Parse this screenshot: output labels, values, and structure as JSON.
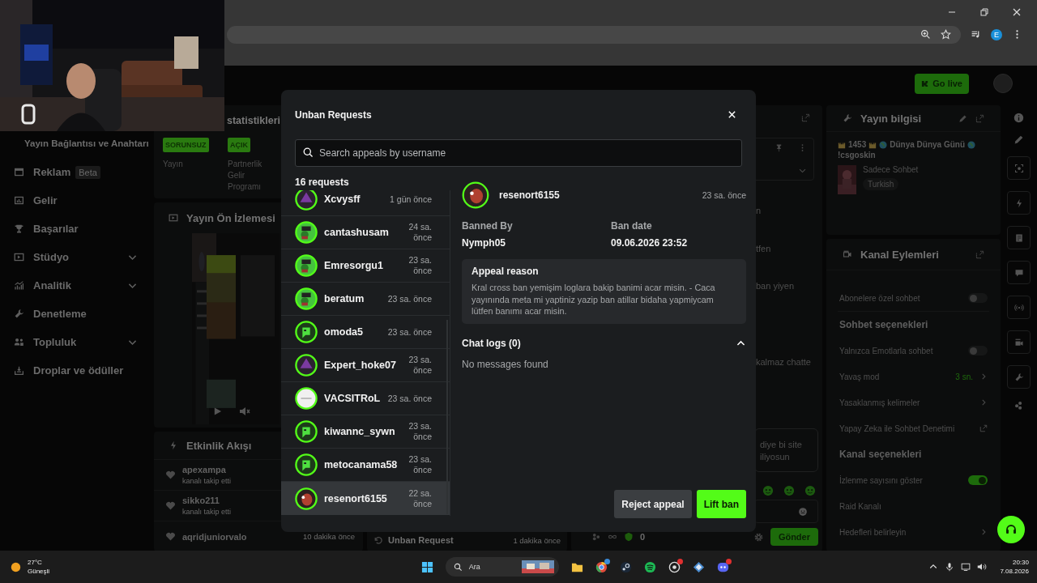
{
  "browser": {
    "profile_initial": "E"
  },
  "header": {
    "go_live": "Go live"
  },
  "sidebar": {
    "title": "Yayın Bağlantısı ve Anahtarı",
    "items": [
      {
        "label": "Reklam",
        "badge": "Beta",
        "expandable": false
      },
      {
        "label": "Gelir",
        "expandable": false
      },
      {
        "label": "Başarılar",
        "expandable": false
      },
      {
        "label": "Stüdyo",
        "expandable": true
      },
      {
        "label": "Analitik",
        "expandable": true
      },
      {
        "label": "Denetleme",
        "expandable": false
      },
      {
        "label": "Topluluk",
        "expandable": true
      },
      {
        "label": "Droplar ve ödüller",
        "expandable": false
      }
    ]
  },
  "stats": {
    "title": "statistikleri",
    "items": [
      {
        "status": "SORUNSUZ",
        "label": "Yayın"
      },
      {
        "status": "AÇIK",
        "label": "Partnerlik Gelir Programı"
      }
    ]
  },
  "preview": {
    "title": "Yayın Ön İzlemesi"
  },
  "activity": {
    "title": "Etkinlik Akışı",
    "events": [
      {
        "user": "apexampa",
        "action": "kanalı takip etti"
      },
      {
        "user": "sikko211",
        "action": "kanalı takip etti"
      },
      {
        "user": "aqridjuniorvalo",
        "time": "10 dakika önce"
      }
    ]
  },
  "mod_log": {
    "title": "Unban Request",
    "time": "1 dakika önce"
  },
  "chat": {
    "messages": [
      "n",
      "tfen",
      "ban yiyen",
      "kalmaz chatte"
    ],
    "reply": [
      "diye bi site",
      "iliyosun"
    ],
    "count": "0",
    "send": "Gönder"
  },
  "stream_info": {
    "title": "Yayın bilgisi",
    "title_parts": [
      "1453",
      "Dünya Dünya Günü",
      "!csgoskin"
    ],
    "category": "Sadece Sohbet",
    "tag": "Turkish"
  },
  "channel_actions": {
    "title": "Kanal Eylemleri",
    "rows": [
      {
        "kind": "toggle",
        "label": "Abonelere özel sohbet",
        "on": false
      },
      {
        "kind": "heading",
        "label": "Sohbet seçenekleri"
      },
      {
        "kind": "toggle",
        "label": "Yalnızca Emotlarla sohbet",
        "on": false
      },
      {
        "kind": "link",
        "label": "Yavaş mod",
        "value": "3 sn."
      },
      {
        "kind": "link",
        "label": "Yasaklanmış kelimeler"
      },
      {
        "kind": "external",
        "label": "Yapay Zeka ile Sohbet Denetimi"
      },
      {
        "kind": "heading",
        "label": "Kanal seçenekleri"
      },
      {
        "kind": "toggle",
        "label": "İzlenme sayısını göster",
        "on": true
      },
      {
        "kind": "plain",
        "label": "Raid Kanalı"
      },
      {
        "kind": "link",
        "label": "Hedefleri belirleyin"
      }
    ]
  },
  "modal": {
    "title": "Unban Requests",
    "search": {
      "placeholder": "Search appeals by username"
    },
    "count": "16 requests",
    "requests": [
      {
        "user": "Xcvysff",
        "time": "1 gün önce",
        "kind": "triangle",
        "selected": false
      },
      {
        "user": "cantashusam",
        "time": "24 sa. önce",
        "kind": "frog",
        "selected": false
      },
      {
        "user": "Emresorgu1",
        "time": "23 sa. önce",
        "kind": "frog",
        "selected": false
      },
      {
        "user": "beratum",
        "time": "23 sa. önce",
        "kind": "frog",
        "selected": false
      },
      {
        "user": "omoda5",
        "time": "23 sa. önce",
        "kind": "blob",
        "selected": false
      },
      {
        "user": "Expert_hoke07",
        "time": "23 sa. önce",
        "kind": "triangle",
        "selected": false
      },
      {
        "user": "VACSITRoL",
        "time": "23 sa. önce",
        "kind": "white",
        "selected": false
      },
      {
        "user": "kiwannc_sywn",
        "time": "23 sa. önce",
        "kind": "blob",
        "selected": false
      },
      {
        "user": "metocanama58",
        "time": "23 sa. önce",
        "kind": "blob",
        "selected": false
      },
      {
        "user": "resenort6155",
        "time": "22 sa. önce",
        "kind": "red",
        "selected": true
      }
    ],
    "detail": {
      "user": "resenort6155",
      "time": "23 sa. önce",
      "kind": "red",
      "banned_by_label": "Banned By",
      "banned_by": "Nymph05",
      "ban_date_label": "Ban date",
      "ban_date": "09.06.2026 23:52",
      "reason_label": "Appeal reason",
      "reason": "Kral cross ban yemişim loglara bakip banimi acar misin. - Caca yayınında meta mi yaptiniz yazip ban atillar bidaha yapmiycam lütfen banımı acar misin.",
      "chat_logs": {
        "label": "Chat logs (0)",
        "expanded": true,
        "empty": "No messages found"
      }
    },
    "buttons": [
      {
        "label": "Reject appeal",
        "kind": "secondary"
      },
      {
        "label": "Lift ban",
        "kind": "primary"
      }
    ]
  },
  "taskbar": {
    "temperature": "27°C",
    "weather": "Güneşli",
    "search": "Ara",
    "time": "20:30",
    "date": "7.08.2026"
  }
}
